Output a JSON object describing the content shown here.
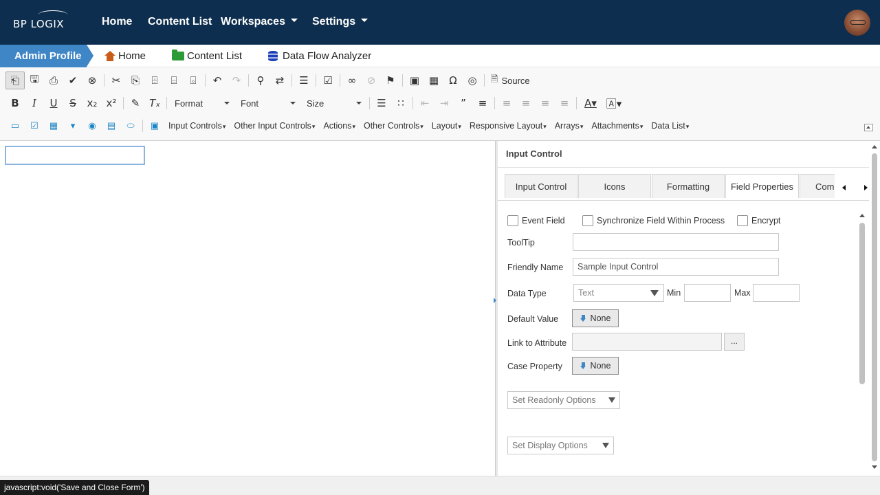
{
  "topnav": {
    "logo": "BP LOGIX",
    "items": [
      {
        "label": "Home"
      },
      {
        "label": "Content List"
      },
      {
        "label": "Workspaces"
      },
      {
        "label": "Settings"
      }
    ]
  },
  "breadcrumbs": {
    "active": "Admin Profile",
    "items": [
      {
        "label": "Home",
        "icon": "home-icon"
      },
      {
        "label": "Content List",
        "icon": "folder-icon"
      },
      {
        "label": "Data Flow Analyzer",
        "icon": "database-icon"
      }
    ]
  },
  "toolbar": {
    "source_label": "Source",
    "format_label": "Format",
    "font_label": "Font",
    "size_label": "Size",
    "menus": [
      "Input Controls",
      "Other Input Controls",
      "Actions",
      "Other Controls",
      "Layout",
      "Responsive Layout",
      "Arrays",
      "Attachments",
      "Data List"
    ]
  },
  "panel": {
    "title": "Input Control",
    "tabs": [
      "Input Control",
      "Icons",
      "Formatting",
      "Field Properties",
      "Com"
    ],
    "active_tab": "Field Properties",
    "checkboxes": {
      "event_field": "Event Field",
      "synchronize": "Synchronize Field Within Process",
      "encrypt": "Encrypt"
    },
    "tooltip_label": "ToolTip",
    "tooltip_value": "",
    "friendly_name_label": "Friendly Name",
    "friendly_name_value": "Sample Input Control",
    "data_type_label": "Data Type",
    "data_type_value": "Text",
    "min_label": "Min",
    "max_label": "Max",
    "default_value_label": "Default Value",
    "default_value_button": "None",
    "link_attr_label": "Link to Attribute",
    "link_attr_button": "...",
    "case_property_label": "Case Property",
    "case_property_button": "None",
    "readonly_options": "Set Readonly Options",
    "display_options": "Set Display Options"
  },
  "status": {
    "tooltip": "javascript:void('Save and Close Form')"
  }
}
